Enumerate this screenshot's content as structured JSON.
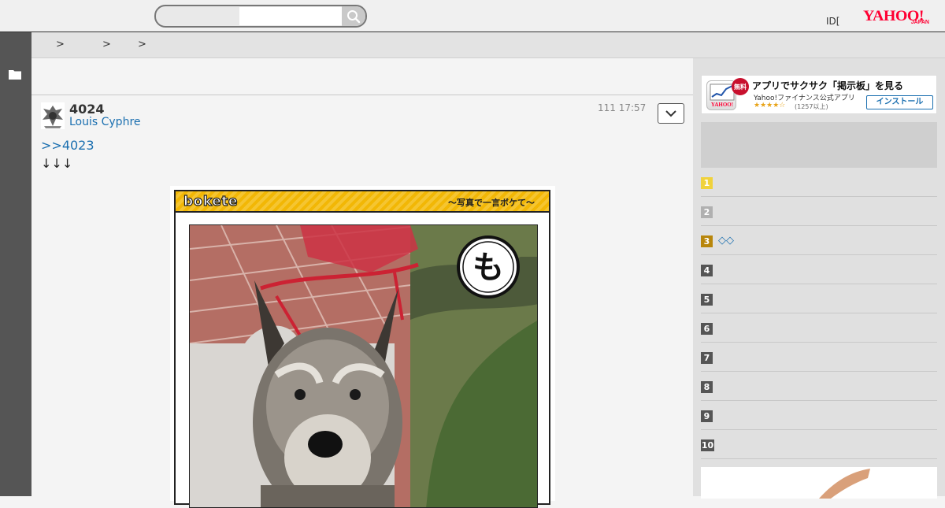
{
  "header": {
    "search": {
      "placeholder": "",
      "value": ""
    },
    "id_link": "ID[",
    "logo": {
      "main": "YAHOO!",
      "sub": "JAPAN"
    }
  },
  "breadcrumb": {
    "separators": [
      ">",
      ">",
      ">"
    ]
  },
  "post": {
    "number": "4024",
    "author": "Louis Cyphre",
    "timestamp": "111 17:57",
    "reply_link": ">>4023",
    "arrows": "↓↓↓",
    "card": {
      "logo": "bokete",
      "tagline": "～写真で一言ボケて～",
      "badge": "も"
    }
  },
  "sidebar": {
    "app_banner": {
      "free_badge": "無料",
      "title": "アプリでサクサク「掲示板」を見る",
      "subtitle": "Yahoo!ファイナンス公式アプリ",
      "stars": "★★★★☆",
      "reviews": "(1257以上)",
      "install": "インストール"
    },
    "ranking": [
      {
        "rank": "1",
        "text": "",
        "color": "#f0d23c"
      },
      {
        "rank": "2",
        "text": "",
        "color": "#b0b0b0"
      },
      {
        "rank": "3",
        "text": "◇◇",
        "color": "#b8860b"
      },
      {
        "rank": "4",
        "text": "",
        "color": "#555555"
      },
      {
        "rank": "5",
        "text": "",
        "color": "#555555"
      },
      {
        "rank": "6",
        "text": "",
        "color": "#555555"
      },
      {
        "rank": "7",
        "text": "",
        "color": "#555555"
      },
      {
        "rank": "8",
        "text": "",
        "color": "#555555"
      },
      {
        "rank": "9",
        "text": "",
        "color": "#555555"
      },
      {
        "rank": "10",
        "text": "",
        "color": "#555555"
      }
    ]
  },
  "icons": [
    "search-icon",
    "folder-icon",
    "chevron-down-icon"
  ],
  "colors": {
    "link": "#1a6fb0",
    "brand": "#ff0033",
    "banner": "#f2b705"
  }
}
